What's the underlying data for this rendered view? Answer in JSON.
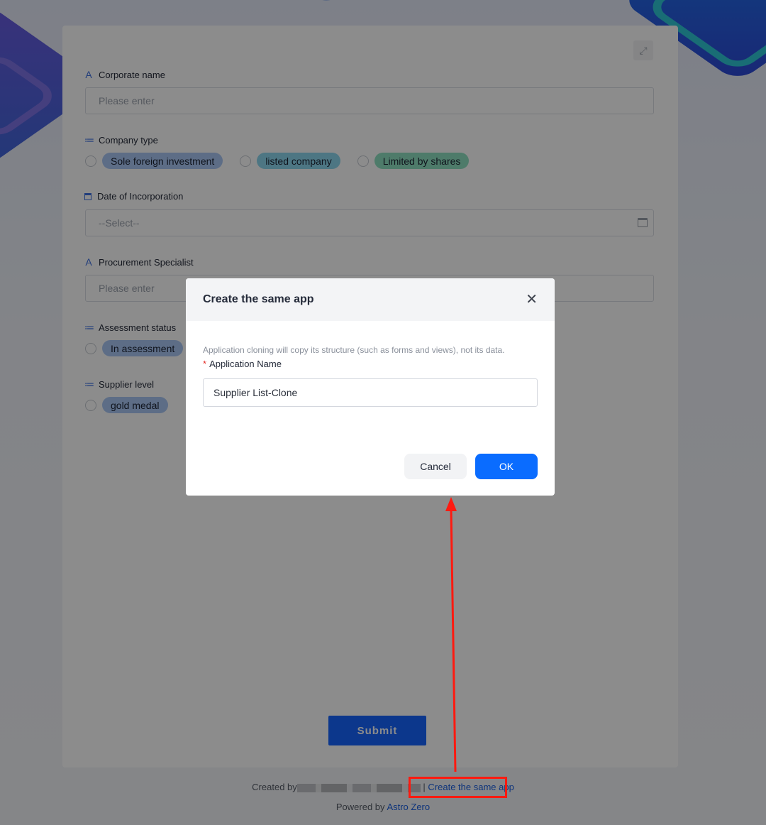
{
  "form": {
    "fields": [
      {
        "label": "Corporate name",
        "placeholder": "Please enter"
      },
      {
        "label": "Company type",
        "options": [
          "Sole foreign investment",
          "listed company",
          "Limited by shares"
        ]
      },
      {
        "label": "Date of Incorporation",
        "placeholder": "--Select--"
      },
      {
        "label": "Procurement Specialist",
        "placeholder": "Please enter"
      },
      {
        "label": "Assessment status",
        "options": [
          "In assessment"
        ]
      },
      {
        "label": "Supplier level",
        "options": [
          "gold medal"
        ]
      }
    ],
    "submit_label": "Submit"
  },
  "colors": {
    "tag_blue": "#a9c6f5",
    "tag_cyan": "#8dd7ef",
    "tag_green": "#8fe0c1",
    "primary": "#1664ff",
    "annotation": "#ff1a10"
  },
  "footer": {
    "created_by": "Created by",
    "separator": "|",
    "create_same_link": "Create the same app",
    "powered_by": "Powered by",
    "brand": "Astro Zero"
  },
  "dialog": {
    "title": "Create the same app",
    "description": "Application cloning will copy its structure (such as forms and views), not its data.",
    "required_mark": "*",
    "name_label": "Application Name",
    "name_value": "Supplier List-Clone",
    "cancel_label": "Cancel",
    "ok_label": "OK"
  },
  "icons": {
    "text_field": "A",
    "option_field": "≔",
    "close": "✕",
    "expand": "⤢"
  }
}
